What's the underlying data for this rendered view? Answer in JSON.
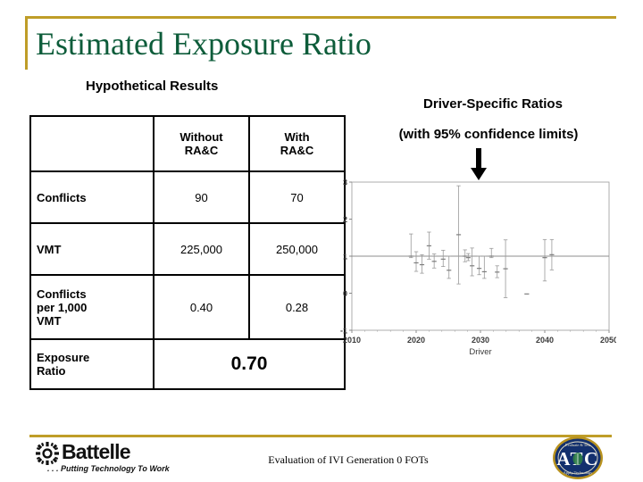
{
  "slide": {
    "title": "Estimated Exposure Ratio",
    "accent_gold": "#bf9d28",
    "title_green": "#0d5c3a"
  },
  "left_panel": {
    "heading": "Hypothetical Results",
    "table": {
      "columns": [
        "",
        "Without RA&C",
        "With RA&C"
      ],
      "column_headers": [
        {
          "line1": "Without",
          "line2": "RA&C"
        },
        {
          "line1": "With",
          "line2": "RA&C"
        }
      ],
      "rows": [
        {
          "label": "Conflicts",
          "without": "90",
          "with": "70"
        },
        {
          "label": "VMT",
          "without": "225,000",
          "with": "250,000"
        },
        {
          "label": "Conflicts per 1,000 VMT",
          "label_line1": "Conflicts",
          "label_line2": "per 1,000",
          "label_line3": "VMT",
          "without": "0.40",
          "with": "0.28"
        }
      ],
      "summary_row": {
        "label_line1": "Exposure",
        "label_line2": "Ratio",
        "value": "0.70"
      }
    }
  },
  "right_panel": {
    "heading": "Driver-Specific Ratios",
    "subheading": "(with 95% confidence limits)",
    "arrow": "down-arrow"
  },
  "chart_data": {
    "type": "scatter",
    "title": "",
    "xlabel": "Driver",
    "ylabel": "",
    "xlim": [
      2010,
      2050
    ],
    "ylim": [
      -1,
      3
    ],
    "xticks": [
      2010,
      2020,
      2030,
      2040,
      2050
    ],
    "yticks": [
      -1,
      0,
      1,
      2,
      3
    ],
    "grid": false,
    "reference_line_y": 1,
    "error_bar_confidence": "95%",
    "point_color": "#9a9a9a",
    "series": [
      {
        "name": "Driver-specific exposure ratio (95% CI)",
        "points": [
          {
            "x": 2019.2,
            "y": 1.0,
            "lo": 0.96,
            "hi": 1.6
          },
          {
            "x": 2020.0,
            "y": 0.82,
            "lo": 0.59,
            "hi": 1.12
          },
          {
            "x": 2020.9,
            "y": 0.77,
            "lo": 0.54,
            "hi": 1.04
          },
          {
            "x": 2022.0,
            "y": 1.28,
            "lo": 0.92,
            "hi": 1.65
          },
          {
            "x": 2022.8,
            "y": 0.86,
            "lo": 0.68,
            "hi": 1.06
          },
          {
            "x": 2024.2,
            "y": 0.92,
            "lo": 0.72,
            "hi": 1.16
          },
          {
            "x": 2025.1,
            "y": 0.62,
            "lo": 0.4,
            "hi": 1.0
          },
          {
            "x": 2026.6,
            "y": 1.58,
            "lo": 0.25,
            "hi": 2.9
          },
          {
            "x": 2027.6,
            "y": 1.0,
            "lo": 0.85,
            "hi": 1.17
          },
          {
            "x": 2028.1,
            "y": 0.96,
            "lo": 0.88,
            "hi": 1.07
          },
          {
            "x": 2028.7,
            "y": 0.74,
            "lo": 0.47,
            "hi": 1.22
          },
          {
            "x": 2029.8,
            "y": 0.67,
            "lo": 0.5,
            "hi": 1.0
          },
          {
            "x": 2030.6,
            "y": 0.58,
            "lo": 0.4,
            "hi": 1.0
          },
          {
            "x": 2031.7,
            "y": 1.0,
            "lo": 0.96,
            "hi": 1.21
          },
          {
            "x": 2032.6,
            "y": 0.57,
            "lo": 0.42,
            "hi": 0.74
          },
          {
            "x": 2033.9,
            "y": 0.66,
            "lo": -0.12,
            "hi": 1.44
          },
          {
            "x": 2037.2,
            "y": -0.02,
            "lo": -0.02,
            "hi": -0.02
          },
          {
            "x": 2040.0,
            "y": 0.96,
            "lo": 0.33,
            "hi": 1.45
          },
          {
            "x": 2041.1,
            "y": 1.04,
            "lo": 0.63,
            "hi": 1.45
          }
        ]
      }
    ]
  },
  "footer": {
    "center_text": "Evaluation of IVI Generation 0 FOTs",
    "battelle": {
      "name": "Battelle",
      "tagline": ". . . Putting Technology To Work"
    },
    "atc": {
      "letters": "ATC",
      "top_text": "Evaluate & Test",
      "bottom_text": "Apply Technology"
    }
  }
}
